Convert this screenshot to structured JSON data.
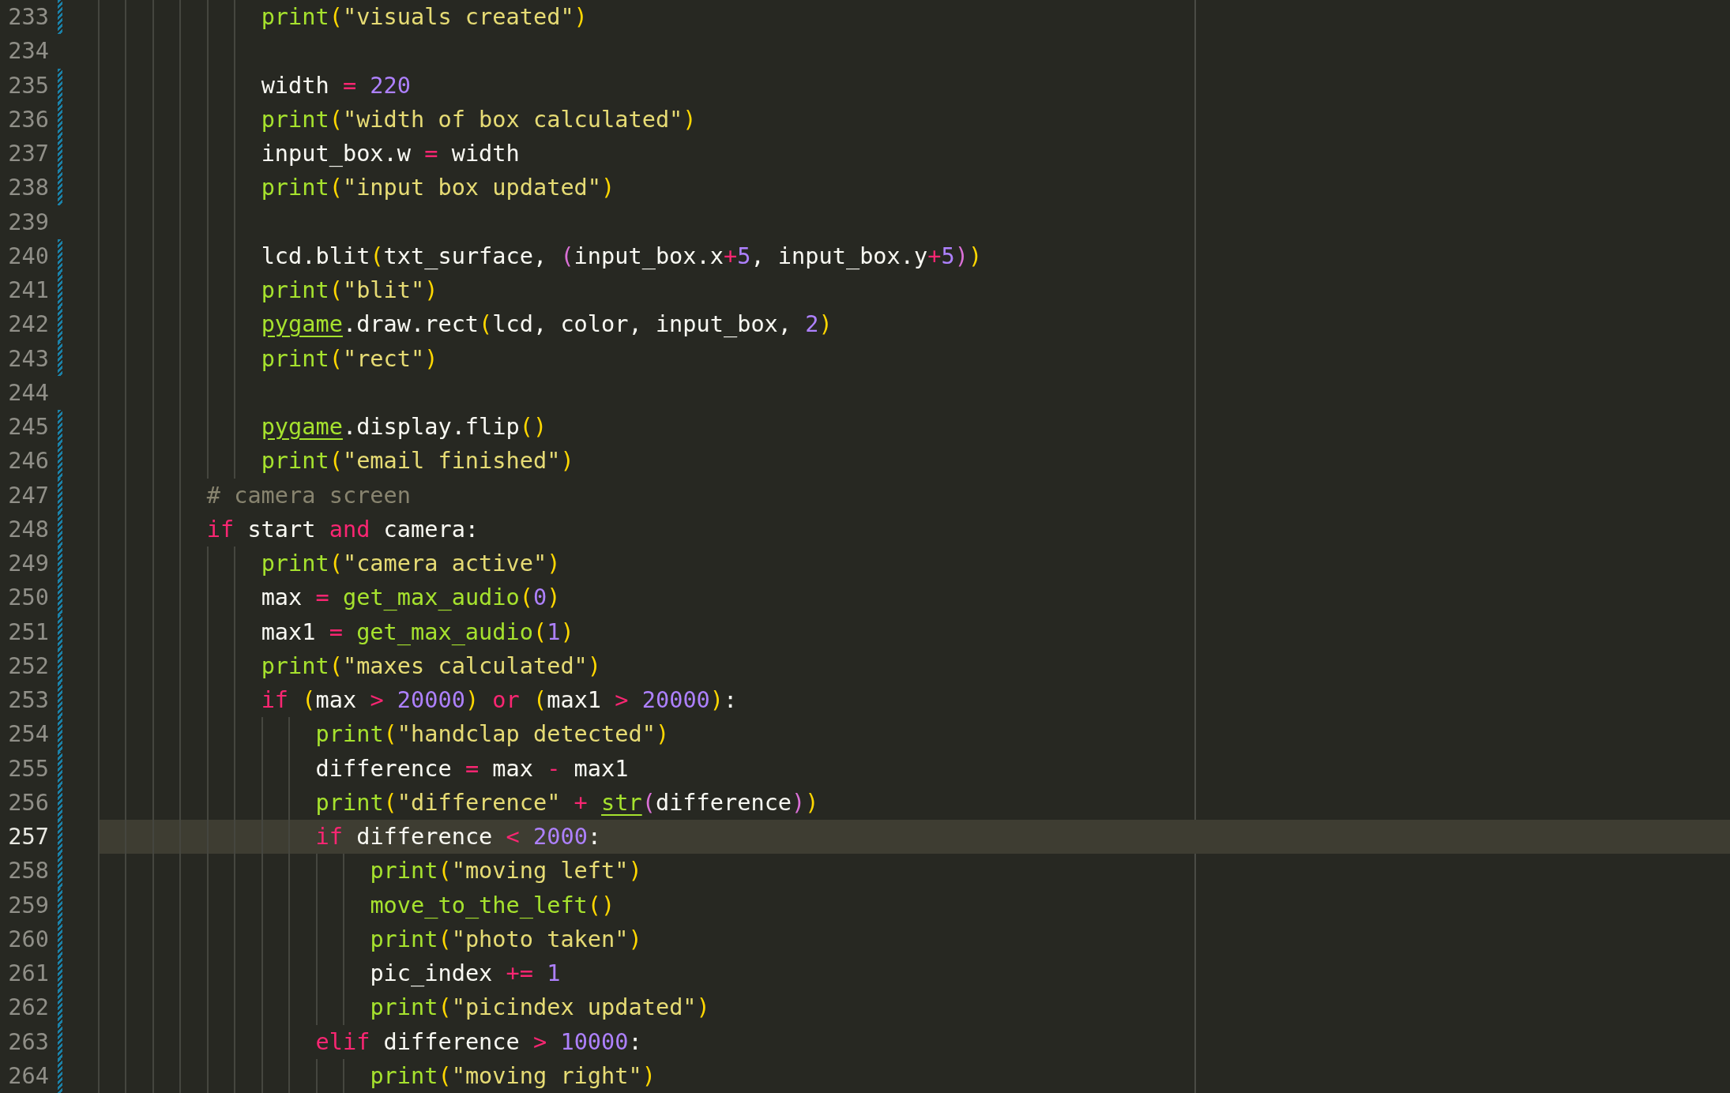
{
  "editor": {
    "lines": [
      {
        "children": [
          {
            "number": "233",
            "modified": true,
            "current": false,
            "tokens": [
              {
                "kind": "function",
                "text": "print"
              },
              {
                "kind": "bracket1",
                "text": "("
              },
              {
                "kind": "string",
                "text": "\"visuals created\""
              },
              {
                "kind": "bracket1",
                "text": ")"
              }
            ]
          },
          {
            "number": "234",
            "modified": false,
            "current": false
          },
          {
            "number": "235",
            "modified": true,
            "current": false,
            "tokens": [
              {
                "kind": "plain",
                "text": "width "
              },
              {
                "kind": "operator",
                "text": "="
              },
              {
                "kind": "number",
                "text": " 220"
              }
            ]
          },
          {
            "number": "236",
            "modified": true,
            "current": false,
            "tokens": [
              {
                "kind": "function",
                "text": "print"
              },
              {
                "kind": "bracket1",
                "text": "("
              },
              {
                "kind": "string",
                "text": "\"width of box calculated\""
              },
              {
                "kind": "bracket1",
                "text": ")"
              }
            ]
          },
          {
            "number": "237",
            "modified": true,
            "current": false,
            "tokens": [
              {
                "kind": "plain",
                "text": "input_box.w "
              },
              {
                "kind": "operator",
                "text": "="
              },
              {
                "kind": "plain",
                "text": " width"
              }
            ]
          },
          {
            "number": "238",
            "modified": true,
            "current": false,
            "tokens": [
              {
                "kind": "function",
                "text": "print"
              },
              {
                "kind": "bracket1",
                "text": "("
              },
              {
                "kind": "string",
                "text": "\"input box updated\""
              },
              {
                "kind": "bracket1",
                "text": ")"
              }
            ]
          },
          {
            "number": "239",
            "modified": false,
            "current": false
          },
          {
            "number": "240",
            "modified": true,
            "current": false,
            "tokens": [
              {
                "kind": "plain",
                "text": "lcd.blit"
              },
              {
                "kind": "bracket1",
                "text": "("
              },
              {
                "kind": "plain",
                "text": "txt_surface, "
              },
              {
                "kind": "bracket2",
                "text": "("
              },
              {
                "kind": "plain",
                "text": "input_box.x"
              },
              {
                "kind": "operator",
                "text": "+"
              },
              {
                "kind": "number",
                "text": "5"
              },
              {
                "kind": "plain",
                "text": ", input_box.y"
              },
              {
                "kind": "operator",
                "text": "+"
              },
              {
                "kind": "number",
                "text": "5"
              },
              {
                "kind": "bracket2",
                "text": ")"
              },
              {
                "kind": "bracket1",
                "text": ")"
              }
            ]
          },
          {
            "number": "241",
            "modified": true,
            "current": false,
            "tokens": [
              {
                "kind": "function",
                "text": "print"
              },
              {
                "kind": "bracket1",
                "text": "("
              },
              {
                "kind": "string",
                "text": "\"blit\""
              },
              {
                "kind": "bracket1",
                "text": ")"
              }
            ]
          },
          {
            "number": "242",
            "modified": true,
            "current": false,
            "tokens": [
              {
                "kind": "module",
                "text": "pygame"
              },
              {
                "kind": "plain",
                "text": ".draw.rect"
              },
              {
                "kind": "bracket1",
                "text": "("
              },
              {
                "kind": "plain",
                "text": "lcd, color, input_box, "
              },
              {
                "kind": "number",
                "text": "2"
              },
              {
                "kind": "bracket1",
                "text": ")"
              }
            ]
          },
          {
            "number": "243",
            "modified": true,
            "current": false,
            "tokens": [
              {
                "kind": "function",
                "text": "print"
              },
              {
                "kind": "bracket1",
                "text": "("
              },
              {
                "kind": "string",
                "text": "\"rect\""
              },
              {
                "kind": "bracket1",
                "text": ")"
              }
            ]
          },
          {
            "number": "244",
            "modified": false,
            "current": false
          },
          {
            "number": "245",
            "modified": true,
            "current": false,
            "tokens": [
              {
                "kind": "module",
                "text": "pygame"
              },
              {
                "kind": "plain",
                "text": ".display.flip"
              },
              {
                "kind": "bracket1",
                "text": "()"
              }
            ]
          },
          {
            "number": "246",
            "modified": true,
            "current": false,
            "tokens": [
              {
                "kind": "function",
                "text": "print"
              },
              {
                "kind": "bracket1",
                "text": "("
              },
              {
                "kind": "string",
                "text": "\"email finished\""
              },
              {
                "kind": "bracket1",
                "text": ")"
              }
            ]
          }
        ]
      },
      {
        "number": "247",
        "modified": true,
        "current": false,
        "tokens": [
          {
            "kind": "comment",
            "text": "# camera screen"
          }
        ]
      },
      {
        "number": "248",
        "modified": true,
        "current": false,
        "tokens": [
          {
            "kind": "keyword",
            "text": "if"
          },
          {
            "kind": "plain",
            "text": " start "
          },
          {
            "kind": "keyword",
            "text": "and"
          },
          {
            "kind": "plain",
            "text": " camera:"
          }
        ],
        "children": [
          {
            "number": "249",
            "modified": true,
            "current": false,
            "tokens": [
              {
                "kind": "function",
                "text": "print"
              },
              {
                "kind": "bracket1",
                "text": "("
              },
              {
                "kind": "string",
                "text": "\"camera active\""
              },
              {
                "kind": "bracket1",
                "text": ")"
              }
            ]
          },
          {
            "number": "250",
            "modified": true,
            "current": false,
            "tokens": [
              {
                "kind": "plain",
                "text": "max "
              },
              {
                "kind": "operator",
                "text": "="
              },
              {
                "kind": "function",
                "text": " get_max_audio"
              },
              {
                "kind": "bracket1",
                "text": "("
              },
              {
                "kind": "number",
                "text": "0"
              },
              {
                "kind": "bracket1",
                "text": ")"
              }
            ]
          },
          {
            "number": "251",
            "modified": true,
            "current": false,
            "tokens": [
              {
                "kind": "plain",
                "text": "max1 "
              },
              {
                "kind": "operator",
                "text": "="
              },
              {
                "kind": "function",
                "text": " get_max_audio"
              },
              {
                "kind": "bracket1",
                "text": "("
              },
              {
                "kind": "number",
                "text": "1"
              },
              {
                "kind": "bracket1",
                "text": ")"
              }
            ]
          },
          {
            "number": "252",
            "modified": true,
            "current": false,
            "tokens": [
              {
                "kind": "function",
                "text": "print"
              },
              {
                "kind": "bracket1",
                "text": "("
              },
              {
                "kind": "string",
                "text": "\"maxes calculated\""
              },
              {
                "kind": "bracket1",
                "text": ")"
              }
            ]
          },
          {
            "number": "253",
            "modified": true,
            "current": false,
            "tokens": [
              {
                "kind": "keyword",
                "text": "if"
              },
              {
                "kind": "bracket1",
                "text": " ("
              },
              {
                "kind": "plain",
                "text": "max "
              },
              {
                "kind": "operator",
                "text": ">"
              },
              {
                "kind": "number",
                "text": " 20000"
              },
              {
                "kind": "bracket1",
                "text": ")"
              },
              {
                "kind": "keyword",
                "text": " or "
              },
              {
                "kind": "bracket1",
                "text": "("
              },
              {
                "kind": "plain",
                "text": "max1 "
              },
              {
                "kind": "operator",
                "text": ">"
              },
              {
                "kind": "number",
                "text": " 20000"
              },
              {
                "kind": "bracket1",
                "text": ")"
              },
              {
                "kind": "plain",
                "text": ":"
              }
            ],
            "children": [
              {
                "number": "254",
                "modified": true,
                "current": false,
                "tokens": [
                  {
                    "kind": "function",
                    "text": "print"
                  },
                  {
                    "kind": "bracket1",
                    "text": "("
                  },
                  {
                    "kind": "string",
                    "text": "\"handclap detected\""
                  },
                  {
                    "kind": "bracket1",
                    "text": ")"
                  }
                ]
              },
              {
                "number": "255",
                "modified": true,
                "current": false,
                "tokens": [
                  {
                    "kind": "plain",
                    "text": "difference "
                  },
                  {
                    "kind": "operator",
                    "text": "="
                  },
                  {
                    "kind": "plain",
                    "text": " max "
                  },
                  {
                    "kind": "operator",
                    "text": "-"
                  },
                  {
                    "kind": "plain",
                    "text": " max1"
                  }
                ]
              },
              {
                "number": "256",
                "modified": true,
                "current": false,
                "tokens": [
                  {
                    "kind": "function",
                    "text": "print"
                  },
                  {
                    "kind": "bracket1",
                    "text": "("
                  },
                  {
                    "kind": "string",
                    "text": "\"difference\""
                  },
                  {
                    "kind": "operator",
                    "text": " + "
                  },
                  {
                    "kind": "module",
                    "text": "str"
                  },
                  {
                    "kind": "bracket2",
                    "text": "("
                  },
                  {
                    "kind": "plain",
                    "text": "difference"
                  },
                  {
                    "kind": "bracket2",
                    "text": ")"
                  },
                  {
                    "kind": "bracket1",
                    "text": ")"
                  }
                ]
              },
              {
                "number": "257",
                "modified": true,
                "current": true,
                "tokens": [
                  {
                    "kind": "keyword",
                    "text": "if"
                  },
                  {
                    "kind": "plain",
                    "text": " difference "
                  },
                  {
                    "kind": "operator",
                    "text": "<"
                  },
                  {
                    "kind": "number",
                    "text": " 2000"
                  },
                  {
                    "kind": "plain",
                    "text": ":"
                  }
                ],
                "children": [
                  {
                    "number": "258",
                    "modified": true,
                    "current": false,
                    "tokens": [
                      {
                        "kind": "function",
                        "text": "print"
                      },
                      {
                        "kind": "bracket1",
                        "text": "("
                      },
                      {
                        "kind": "string",
                        "text": "\"moving left\""
                      },
                      {
                        "kind": "bracket1",
                        "text": ")"
                      }
                    ]
                  },
                  {
                    "number": "259",
                    "modified": true,
                    "current": false,
                    "tokens": [
                      {
                        "kind": "function",
                        "text": "move_to_the_left"
                      },
                      {
                        "kind": "bracket1",
                        "text": "()"
                      }
                    ]
                  },
                  {
                    "number": "260",
                    "modified": true,
                    "current": false,
                    "tokens": [
                      {
                        "kind": "function",
                        "text": "print"
                      },
                      {
                        "kind": "bracket1",
                        "text": "("
                      },
                      {
                        "kind": "string",
                        "text": "\"photo taken\""
                      },
                      {
                        "kind": "bracket1",
                        "text": ")"
                      }
                    ]
                  },
                  {
                    "number": "261",
                    "modified": true,
                    "current": false,
                    "tokens": [
                      {
                        "kind": "plain",
                        "text": "pic_index "
                      },
                      {
                        "kind": "operator",
                        "text": "+="
                      },
                      {
                        "kind": "number",
                        "text": " 1"
                      }
                    ]
                  },
                  {
                    "number": "262",
                    "modified": true,
                    "current": false,
                    "tokens": [
                      {
                        "kind": "function",
                        "text": "print"
                      },
                      {
                        "kind": "bracket1",
                        "text": "("
                      },
                      {
                        "kind": "string",
                        "text": "\"picindex updated\""
                      },
                      {
                        "kind": "bracket1",
                        "text": ")"
                      }
                    ]
                  }
                ]
              },
              {
                "number": "263",
                "modified": true,
                "current": false,
                "tokens": [
                  {
                    "kind": "keyword",
                    "text": "elif"
                  },
                  {
                    "kind": "plain",
                    "text": " difference "
                  },
                  {
                    "kind": "operator",
                    "text": ">"
                  },
                  {
                    "kind": "number",
                    "text": " 10000"
                  },
                  {
                    "kind": "plain",
                    "text": ":"
                  }
                ],
                "children": [
                  {
                    "number": "264",
                    "modified": true,
                    "current": false,
                    "tokens": [
                      {
                        "kind": "function",
                        "text": "print"
                      },
                      {
                        "kind": "bracket1",
                        "text": "("
                      },
                      {
                        "kind": "string",
                        "text": "\"moving right\""
                      },
                      {
                        "kind": "bracket1",
                        "text": ")"
                      }
                    ]
                  }
                ]
              }
            ]
          }
        ]
      }
    ]
  }
}
